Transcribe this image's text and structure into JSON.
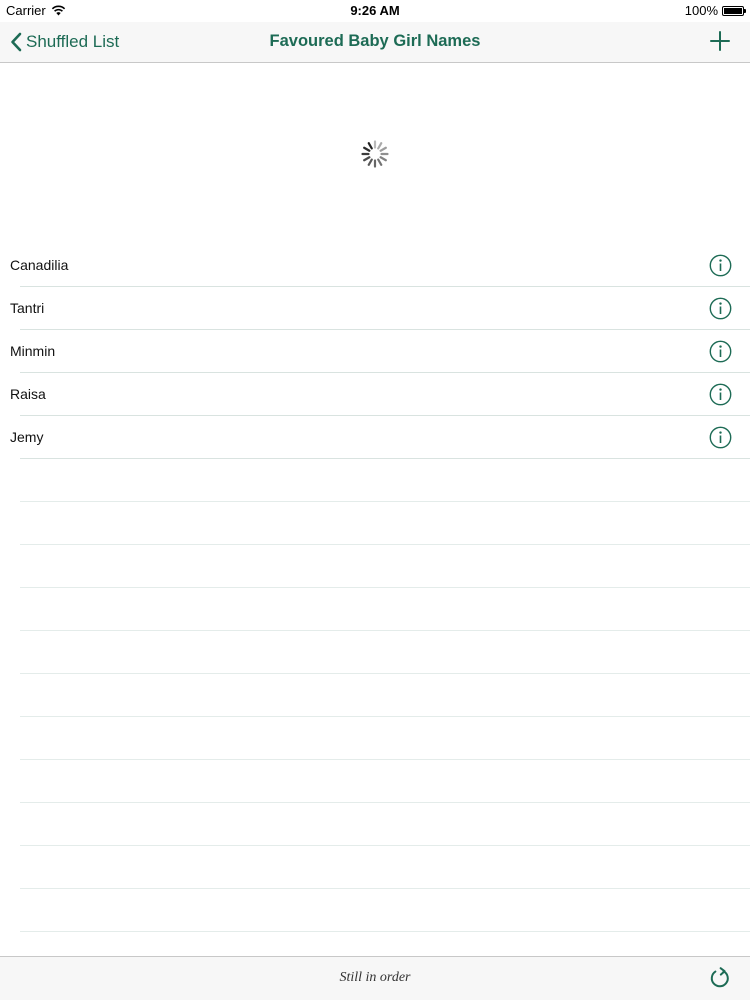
{
  "status_bar": {
    "carrier": "Carrier",
    "time": "9:26 AM",
    "battery": "100%",
    "battery_level": 1.0
  },
  "nav": {
    "back_label": "Shuffled List",
    "title": "Favoured Baby Girl Names",
    "add_icon": "plus-icon",
    "accent_color": "#1d6b55"
  },
  "names": [
    {
      "label": "Canadilia"
    },
    {
      "label": "Tantri"
    },
    {
      "label": "Minmin"
    },
    {
      "label": "Raisa"
    },
    {
      "label": "Jemy"
    }
  ],
  "toolbar": {
    "status": "Still in order",
    "refresh_icon": "refresh-icon"
  }
}
